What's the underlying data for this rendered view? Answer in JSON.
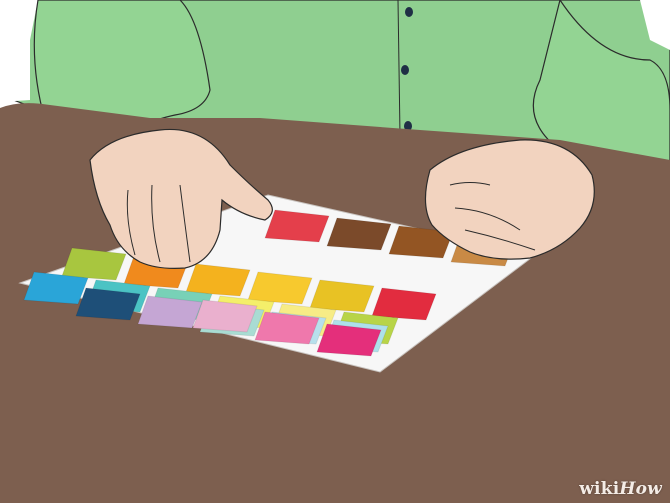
{
  "watermark": {
    "part1": "wiki",
    "part2": "How"
  },
  "colors": {
    "table": "#7d5f4f",
    "shirt": "#8fcf90",
    "skin": "#f2d3bf",
    "card": "#f7f7f7"
  },
  "swatch_rows": [
    [
      "#e43f4b",
      "#7b4a2a",
      "#935523",
      "#c98a45"
    ],
    [
      "#a8c63f",
      "#f08a1d",
      "#f4b21e",
      "#f7c92e",
      "#e8c224",
      "#e22c3f"
    ],
    [
      "#2aa5d8",
      "#4bc3c4",
      "#78d1b7",
      "#f4ef6a",
      "#f7ec86",
      "#b8d448"
    ],
    [
      "#1e4f78",
      "#c5a6d4",
      "#a9dcd3",
      "#b7e0ec",
      "#ade0ea"
    ],
    [
      "#eab0ce",
      "#ef78ac",
      "#e42f7b"
    ]
  ]
}
